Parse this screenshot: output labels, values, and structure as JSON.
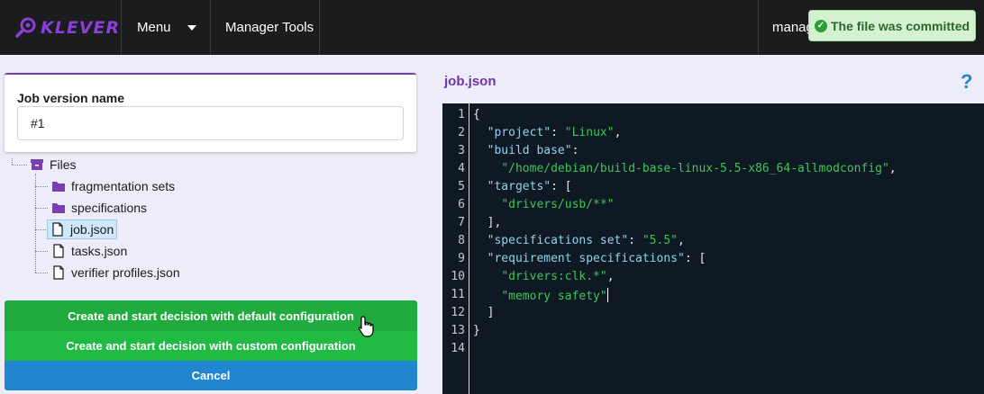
{
  "header": {
    "logo_text": "KLEVER",
    "menu_label": "Menu",
    "manager_tools_label": "Manager Tools",
    "user_label": "manag"
  },
  "toast": {
    "message": "The file was committed",
    "color": "#2c662d"
  },
  "version": {
    "label": "Job version name",
    "value": "#1"
  },
  "tree": {
    "root": {
      "label": "Files",
      "icon": "archive-icon"
    },
    "items": [
      {
        "label": "fragmentation sets",
        "icon": "folder-icon"
      },
      {
        "label": "specifications",
        "icon": "folder-icon"
      },
      {
        "label": "job.json",
        "icon": "file-icon",
        "selected": true
      },
      {
        "label": "tasks.json",
        "icon": "file-icon"
      },
      {
        "label": "verifier profiles.json",
        "icon": "file-icon"
      }
    ]
  },
  "buttons": {
    "default_config": "Create and start decision with default configuration",
    "custom_config": "Create and start decision with custom configuration",
    "cancel": "Cancel"
  },
  "editor": {
    "file_name": "job.json",
    "help_icon": "?",
    "line_numbers": [
      "1",
      "2",
      "3",
      "4",
      "5",
      "6",
      "7",
      "8",
      "9",
      "10",
      "11",
      "12",
      "13",
      "14"
    ],
    "lines": [
      [
        {
          "t": "p",
          "v": "{"
        }
      ],
      [
        {
          "t": "p",
          "v": "  "
        },
        {
          "t": "k",
          "v": "\"project\""
        },
        {
          "t": "p",
          "v": ": "
        },
        {
          "t": "s",
          "v": "\"Linux\""
        },
        {
          "t": "p",
          "v": ","
        }
      ],
      [
        {
          "t": "p",
          "v": "  "
        },
        {
          "t": "k",
          "v": "\"build base\""
        },
        {
          "t": "p",
          "v": ":"
        }
      ],
      [
        {
          "t": "p",
          "v": "    "
        },
        {
          "t": "s",
          "v": "\"/home/debian/build-base-linux-5.5-x86_64-allmodconfig\""
        },
        {
          "t": "p",
          "v": ","
        }
      ],
      [
        {
          "t": "p",
          "v": "  "
        },
        {
          "t": "k",
          "v": "\"targets\""
        },
        {
          "t": "p",
          "v": ": ["
        }
      ],
      [
        {
          "t": "p",
          "v": "    "
        },
        {
          "t": "s",
          "v": "\"drivers/usb/**\""
        }
      ],
      [
        {
          "t": "p",
          "v": "  ],"
        }
      ],
      [
        {
          "t": "p",
          "v": "  "
        },
        {
          "t": "k",
          "v": "\"specifications set\""
        },
        {
          "t": "p",
          "v": ": "
        },
        {
          "t": "s",
          "v": "\"5.5\""
        },
        {
          "t": "p",
          "v": ","
        }
      ],
      [
        {
          "t": "p",
          "v": "  "
        },
        {
          "t": "k",
          "v": "\"requirement specifications\""
        },
        {
          "t": "p",
          "v": ": ["
        }
      ],
      [
        {
          "t": "p",
          "v": "    "
        },
        {
          "t": "s",
          "v": "\"drivers:clk.*\""
        },
        {
          "t": "p",
          "v": ","
        }
      ],
      [
        {
          "t": "p",
          "v": "    "
        },
        {
          "t": "s",
          "v": "\"memory safety\""
        },
        {
          "t": "c",
          "v": ""
        }
      ],
      [
        {
          "t": "p",
          "v": "  ]"
        }
      ],
      [
        {
          "t": "p",
          "v": "}"
        }
      ],
      [
        {
          "t": "p",
          "v": ""
        }
      ]
    ],
    "key_color": "#8fd3f0",
    "string_color": "#3ec45a",
    "background": "#0f1923"
  },
  "colors": {
    "accent": "#7b3fb0",
    "success": "#21ba45",
    "primary": "#2185d0"
  }
}
